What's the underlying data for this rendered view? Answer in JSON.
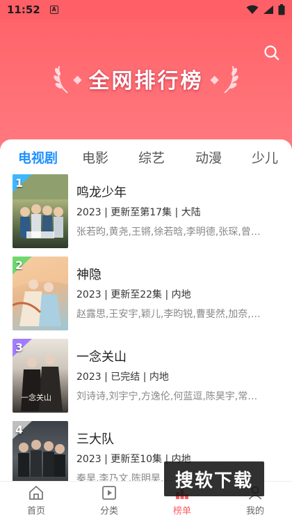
{
  "status_bar": {
    "time": "11:52",
    "badge": "A"
  },
  "header": {
    "title": "全网排行榜",
    "bg_color": "#ff6469"
  },
  "tabs": [
    {
      "label": "电视剧",
      "active": true
    },
    {
      "label": "电影",
      "active": false
    },
    {
      "label": "综艺",
      "active": false
    },
    {
      "label": "动漫",
      "active": false
    },
    {
      "label": "少儿",
      "active": false
    }
  ],
  "items": [
    {
      "rank": "1",
      "rank_color": "#3fb7ff",
      "title": "鸣龙少年",
      "meta": "2023 | 更新至第17集 | 大陆",
      "cast": "张若昀,黄尧,王锵,徐若晗,李明德,张琛,曾宥..."
    },
    {
      "rank": "2",
      "rank_color": "#6fd96f",
      "title": "神隐",
      "meta": "2023 | 更新至22集 | 内地",
      "cast": "赵露思,王安宇,颖儿,李昀锐,曹斐然,加奈,薛..."
    },
    {
      "rank": "3",
      "rank_color": "#a27cff",
      "title": "一念关山",
      "meta": "2023 | 已完结 | 内地",
      "cast": "刘诗诗,刘宇宁,方逸伦,何蓝逗,陈昊宇,常华森..."
    },
    {
      "rank": "4",
      "rank_color": "#bfbfbf",
      "title": "三大队",
      "meta": "2023 | 更新至10集 | 内地",
      "cast": "秦昊,李乃文,陈明昊,..."
    }
  ],
  "bottom_nav": [
    {
      "label": "首页",
      "icon": "home-icon",
      "active": false
    },
    {
      "label": "分类",
      "icon": "category-icon",
      "active": false
    },
    {
      "label": "榜单",
      "icon": "ranking-icon",
      "active": true
    },
    {
      "label": "我的",
      "icon": "profile-icon",
      "active": false
    }
  ],
  "watermark": {
    "text": "搜软下载"
  },
  "colors": {
    "accent": "#1e90ff",
    "brand": "#ff5f66"
  }
}
